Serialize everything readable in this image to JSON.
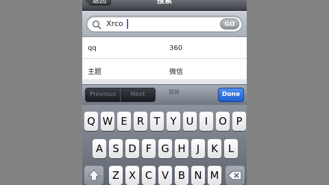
{
  "nav": {
    "back_label": "返回",
    "title": "搜索"
  },
  "search": {
    "value": "Xrco",
    "go_label": "GO"
  },
  "list": [
    {
      "left": "qq",
      "right": "360"
    },
    {
      "left": "主题",
      "right": "微信"
    }
  ],
  "accessory": {
    "previous_label": "Previous",
    "next_label": "Next",
    "center_label": "简体",
    "done_label": "Done"
  },
  "keyboard": {
    "row1": [
      "Q",
      "W",
      "E",
      "R",
      "T",
      "Y",
      "U",
      "I",
      "O",
      "P"
    ],
    "row2": [
      "A",
      "S",
      "D",
      "F",
      "G",
      "H",
      "J",
      "K",
      "L"
    ],
    "row3": [
      "Z",
      "X",
      "C",
      "V",
      "B",
      "N",
      "M"
    ]
  },
  "colors": {
    "accent_done": "#1e5fd2",
    "nav_bar": "#3c3f45",
    "page_background": "#838383"
  },
  "icons": {
    "search": "search-icon",
    "shift": "shift-icon",
    "delete": "delete-icon"
  }
}
